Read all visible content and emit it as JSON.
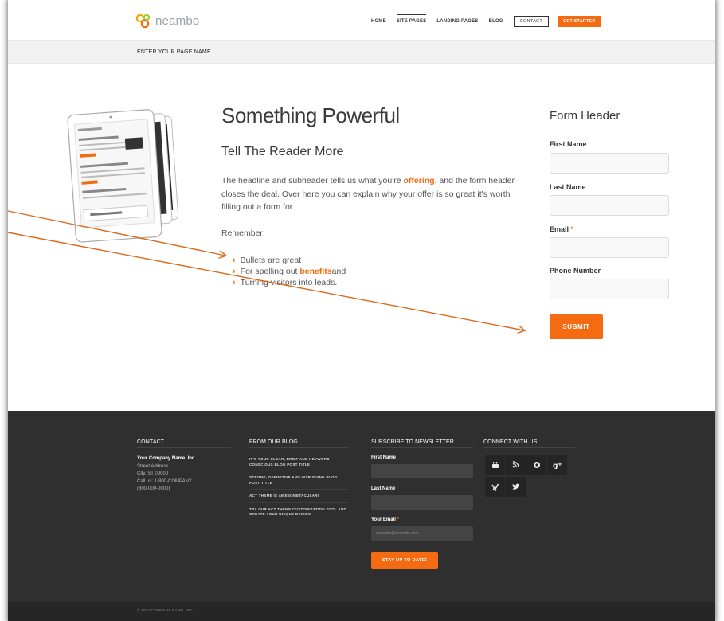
{
  "header": {
    "logo_text": "neambo",
    "nav": [
      "HOME",
      "SITE PAGES",
      "LANDING PAGES",
      "BLOG"
    ],
    "contact_label": "CONTACT",
    "cta_label": "GET STARTED"
  },
  "pagebar": {
    "title": "ENTER YOUR PAGE NAME"
  },
  "main": {
    "headline": "Something Powerful",
    "subheadline": "Tell The Reader More",
    "body_pre": "The headline and subheader tells us what you're ",
    "body_hl": "offering",
    "body_post": ", and the form header closes the deal. Over here you can explain why your offer is so great it's worth filling out a form for.",
    "remember": "Remember:",
    "bullet1": "Bullets are great",
    "bullet2_pre": "For spelling out ",
    "bullet2_hl": "benefits",
    "bullet2_post": " and",
    "bullet3": "Turning visitors into leads."
  },
  "form": {
    "header": "Form Header",
    "first_name": "First Name",
    "last_name": "Last Name",
    "email": "Email",
    "email_req": "*",
    "phone": "Phone Number",
    "submit": "SUBMIT"
  },
  "footer": {
    "contact": {
      "heading": "CONTACT",
      "company": "Your Company Name, Inc.",
      "street": "Street Address",
      "city": "City, ST 00000",
      "call": "Call us: 1-800-COMPANY",
      "phone": "(800-000-0000)"
    },
    "blog": {
      "heading": "FROM OUR BLOG",
      "posts": [
        "IT'S YOUR CLEAR, BRIEF AND KEYWORD CONSCIOUS BLOG POST TITLE",
        "STRONG, DEFINITIVE AND INTRIGUING BLOG POST TITLE",
        "ACT THEME IS AWESOMETACULAR!",
        "TRY OUR ACT THEME CUSTOMIZATION TOOL AND CREATE YOUR UNIQUE DESIGN"
      ]
    },
    "newsletter": {
      "heading": "SUBSCRIBE TO NEWSLETTER",
      "first_name": "First Name",
      "last_name": "Last Name",
      "email": "Your Email",
      "email_req": "*",
      "email_placeholder": "example@example.com",
      "button": "STAY UP TO DATE!"
    },
    "connect": {
      "heading": "CONNECT WITH US"
    },
    "copyright": "© 2014 COMPANY NAME, INC."
  },
  "colors": {
    "accent": "#f46b12",
    "footer_bg": "#2f2f2f",
    "annotation": "#d96a1c"
  },
  "icons": [
    "youtube-icon",
    "rss-icon",
    "pinterest-icon",
    "google-plus-icon",
    "xing-icon",
    "twitter-icon"
  ]
}
